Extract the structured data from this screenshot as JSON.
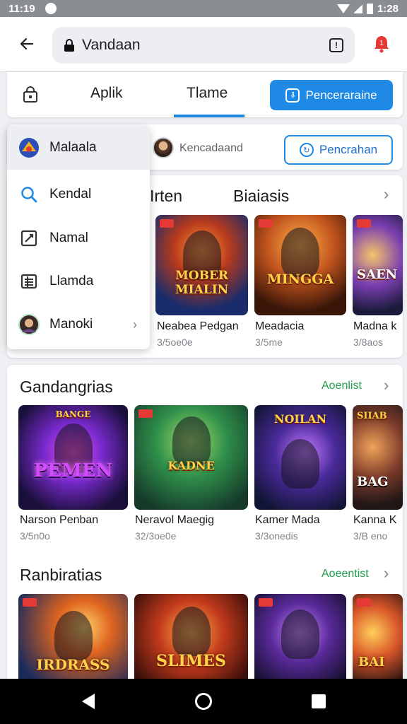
{
  "status_bar": {
    "time_left": "11:19",
    "time_right": "1:28"
  },
  "header": {
    "address": "Vandaan",
    "notification_badge": "1"
  },
  "tab_row": {
    "tabs": [
      {
        "label": "Aplik"
      },
      {
        "label": "Tlame"
      }
    ],
    "active_tab": 1,
    "primary_button": "Penceraraine"
  },
  "account_row": {
    "name": "Kencadaand",
    "outline_button": "Pencrahan"
  },
  "menu": {
    "items": [
      {
        "label": "Malaala",
        "icon": "game-logo-icon"
      },
      {
        "label": "Kendal",
        "icon": "search-icon"
      },
      {
        "label": "Namal",
        "icon": "edit-box-icon"
      },
      {
        "label": "Llamda",
        "icon": "list-icon"
      },
      {
        "label": "Manoki",
        "icon": "avatar-icon"
      }
    ]
  },
  "section1": {
    "title_a": "Irten",
    "title_b": "Biaiasis",
    "games": [
      {
        "name": "Neabea Pedgan",
        "sub": "3/5oe0e",
        "logo": "MOBER MIALIN"
      },
      {
        "name": "Meadacia",
        "sub": "3/5me",
        "logo": "MINGGA"
      },
      {
        "name": "Madna k",
        "sub": "3/8aos",
        "logo": "SAEN"
      }
    ]
  },
  "section2": {
    "title": "Gandangrias",
    "link": "Aoenlist",
    "games": [
      {
        "name": "Narson Penban",
        "sub": "3/5n0o",
        "logo": "PEMEN",
        "top": "BANGE"
      },
      {
        "name": "Neravol Maegig",
        "sub": "32/3oe0e",
        "logo": "KADNE",
        "top": ""
      },
      {
        "name": "Kamer Mada",
        "sub": "3/3onedis",
        "logo": "NOILAN",
        "top": ""
      },
      {
        "name": "Kanna K",
        "sub": "3/B eno",
        "logo": "BAG",
        "top": "SIIAB"
      }
    ]
  },
  "section3": {
    "title": "Ranbiratias",
    "link": "Aoeentist",
    "games": [
      {
        "logo": "IRDRASS"
      },
      {
        "logo": "SLIMES"
      },
      {
        "logo": ""
      },
      {
        "logo": "BAI"
      }
    ]
  },
  "colors": {
    "accent": "#1e8ae6",
    "link_green": "#1e9e4a",
    "badge_red": "#e53935"
  }
}
